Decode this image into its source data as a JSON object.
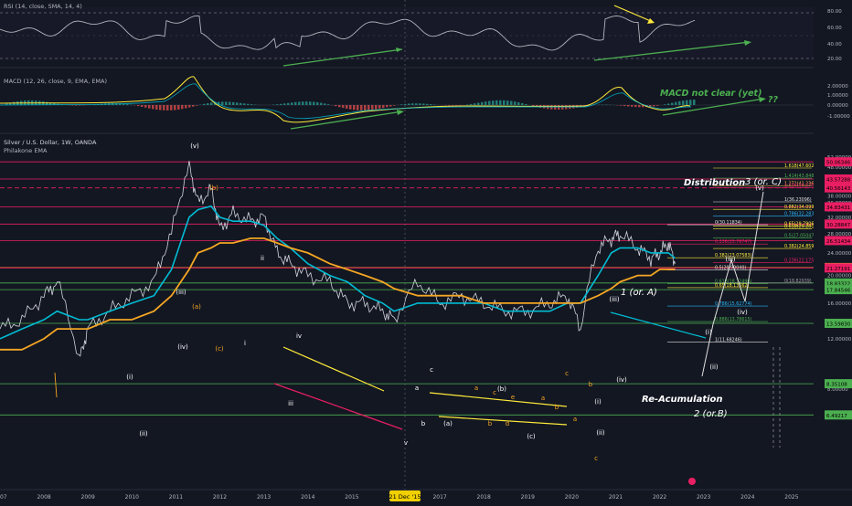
{
  "panes": {
    "rsi": {
      "title": "RSI (14, close, SMA, 14, 4)",
      "ticks": [
        "80.00",
        "60.00",
        "40.00",
        "20.00"
      ]
    },
    "macd": {
      "title": "MACD (12, 26, close, 9, EMA, EMA)",
      "ticks": [
        "2.00000",
        "1.00000",
        "0.00000",
        "-1.00000"
      ],
      "annotation": "MACD not clear (yet)",
      "question": "??"
    },
    "price": {
      "title": "Silver / U.S. Dollar, 1W, OANDA",
      "indicator": "Philakone EMA",
      "ticks": [
        "52.00000",
        "48.00000",
        "44.00000",
        "42.00000",
        "38.00000",
        "36.00000",
        "34.00000",
        "32.00000",
        "28.00000",
        "24.00000",
        "20.00000",
        "16.00000",
        "12.00000",
        "8.00000"
      ]
    }
  },
  "price_tags": [
    {
      "label": "50.06346",
      "color": "#e91e63"
    },
    {
      "label": "43.57288",
      "color": "#e91e63"
    },
    {
      "label": "40.56143",
      "color": "#e91e63"
    },
    {
      "label": "34.83431",
      "color": "#e91e63"
    },
    {
      "label": "30.28847",
      "color": "#e91e63"
    },
    {
      "label": "26.51434",
      "color": "#e91e63"
    },
    {
      "label": "21.32750",
      "color": "#f5a623"
    },
    {
      "label": "21.27191",
      "color": "#e91e63"
    },
    {
      "label": "18.83322",
      "color": "#4caf50"
    },
    {
      "label": "17.84546",
      "color": "#4caf50"
    },
    {
      "label": "13.59830",
      "color": "#4caf50"
    },
    {
      "label": "8.35108",
      "color": "#4caf50"
    },
    {
      "label": "6.49217",
      "color": "#4caf50"
    }
  ],
  "fib_levels": [
    {
      "label": "1.618(47.60276)",
      "color": "#ffeb3b"
    },
    {
      "label": "1.414(43.8489)",
      "color": "#4caf50"
    },
    {
      "label": "1.272(41.23602)",
      "color": "#ffb74d"
    },
    {
      "label": "1.236(40.57059)",
      "color": "#e91e63"
    },
    {
      "label": "1(36.23096)",
      "color": "#e0e0e0"
    },
    {
      "label": "0.882(34.09964)",
      "color": "#ffeb3b"
    },
    {
      "label": "0.786(32.28319)",
      "color": "#29b6f6"
    },
    {
      "label": "0.65(29.79067)",
      "color": "#ffeb3b"
    },
    {
      "label": "0.618(29.20179)",
      "color": "#ffeb3b"
    },
    {
      "label": "0.5(27.05047)",
      "color": "#4caf50"
    },
    {
      "label": "0.382(24.85916)",
      "color": "#ffeb3b"
    },
    {
      "label": "0.236(22.17562)",
      "color": "#e91e63"
    },
    {
      "label": "0(18.82939)",
      "color": "#9e9e9e"
    }
  ],
  "fib_levels_left": [
    {
      "label": "0(30.11834)",
      "color": "#e0e0e0"
    },
    {
      "label": "0.236(25.76747)",
      "color": "#e91e63"
    },
    {
      "label": "0.382(23.07583)",
      "color": "#ffeb3b"
    },
    {
      "label": "0.5(20.90040)",
      "color": "#e0e0e0"
    },
    {
      "label": "0.618(18.72496)",
      "color": "#4caf50"
    },
    {
      "label": "0.65(18.13562)",
      "color": "#ffeb3b"
    },
    {
      "label": "0.786(15.62774)",
      "color": "#29b6f6"
    },
    {
      "label": "0.886(13.78615)",
      "color": "#4caf50"
    },
    {
      "label": "1(11.68246)",
      "color": "#e0e0e0"
    }
  ],
  "wave_labels": [
    {
      "text": "(v)",
      "color": "#ffffff"
    },
    {
      "text": "(b)",
      "color": "#f5a623"
    },
    {
      "text": "(iii)",
      "color": "#ffffff"
    },
    {
      "text": "(a)",
      "color": "#f5a623"
    },
    {
      "text": "(iv)",
      "color": "#ffffff"
    },
    {
      "text": "(c)",
      "color": "#f5a623"
    },
    {
      "text": "ii",
      "color": "#ffffff"
    },
    {
      "text": "i",
      "color": "#ffffff"
    },
    {
      "text": "(i)",
      "color": "#ffffff"
    },
    {
      "text": "(ii)",
      "color": "#ffffff"
    },
    {
      "text": "iii",
      "color": "#ffffff"
    },
    {
      "text": "iv",
      "color": "#ffffff"
    },
    {
      "text": "v",
      "color": "#ffffff"
    },
    {
      "text": "a",
      "color": "#ffffff"
    },
    {
      "text": "b",
      "color": "#ffffff"
    },
    {
      "text": "c",
      "color": "#ffffff"
    },
    {
      "text": "(a)",
      "color": "#ffffff"
    },
    {
      "text": "(b)",
      "color": "#ffffff"
    },
    {
      "text": "(c)",
      "color": "#ffffff"
    },
    {
      "text": "a",
      "color": "#f5a623"
    },
    {
      "text": "b",
      "color": "#f5a623"
    },
    {
      "text": "c",
      "color": "#f5a623"
    },
    {
      "text": "d",
      "color": "#f5a623"
    },
    {
      "text": "e",
      "color": "#f5a623"
    },
    {
      "text": "a",
      "color": "#f5a623"
    },
    {
      "text": "b",
      "color": "#f5a623"
    },
    {
      "text": "c",
      "color": "#f5a623"
    },
    {
      "text": "(i)",
      "color": "#ffffff"
    },
    {
      "text": "(ii)",
      "color": "#ffffff"
    },
    {
      "text": "(iii)",
      "color": "#ffffff"
    },
    {
      "text": "(iv)",
      "color": "#ffffff"
    },
    {
      "text": "a",
      "color": "#f5a623"
    },
    {
      "text": "b",
      "color": "#f5a623"
    },
    {
      "text": "c",
      "color": "#f5a623"
    },
    {
      "text": "(i)",
      "color": "#ffffff"
    },
    {
      "text": "(ii)",
      "color": "#ffffff"
    },
    {
      "text": "(iii)",
      "color": "#ffffff"
    },
    {
      "text": "(iv)",
      "color": "#ffffff"
    },
    {
      "text": "(v)",
      "color": "#ffffff"
    }
  ],
  "annotations": {
    "wave1": "1 (or. A)",
    "wave2": "2 (or.B)",
    "wave3": "3 (or. C)",
    "distribution": "Distribution",
    "reaccumulation": "Re-Acumulation"
  },
  "x_axis": {
    "ticks": [
      "2007",
      "2008",
      "2009",
      "2010",
      "2011",
      "2012",
      "2013",
      "2014",
      "2015",
      "2017",
      "2018",
      "2019",
      "2020",
      "2021",
      "2022",
      "2023",
      "2024",
      "2025"
    ],
    "highlight": "21 Dec '15"
  },
  "colors": {
    "background": "#131722",
    "price_line": "#d1d4dc",
    "ema_fast": "#00bcd4",
    "ema_slow": "#f5a623",
    "rsi_line": "#b2b5be",
    "trend_green": "#4caf50",
    "trend_red": "#e91e63",
    "macd_line": "#ffeb3b"
  },
  "chart_data": {
    "type": "line",
    "title": "Silver / U.S. Dollar, 1W, OANDA",
    "x": [
      2007,
      2007.5,
      2008,
      2008.3,
      2008.8,
      2009,
      2009.5,
      2010,
      2010.5,
      2010.9,
      2011.3,
      2011.5,
      2011.8,
      2012,
      2012.3,
      2012.7,
      2013,
      2013.3,
      2013.6,
      2014,
      2014.5,
      2014.9,
      2015.3,
      2015.7,
      2015.96,
      2016.5,
      2017,
      2017.5,
      2018,
      2018.5,
      2019,
      2019.5,
      2019.9,
      2020.2,
      2020.6,
      2020.9,
      2021.1,
      2021.5,
      2021.8,
      2022,
      2022.2,
      2022.35
    ],
    "values": [
      13,
      14,
      17,
      19,
      10,
      13,
      15,
      17,
      19,
      28,
      48,
      36,
      40,
      29,
      33,
      31,
      32,
      24,
      22,
      20,
      19,
      16,
      16,
      15,
      14,
      19,
      16,
      17,
      16,
      15,
      15,
      16,
      17,
      13,
      25,
      27,
      28,
      25,
      23,
      24,
      26,
      22
    ],
    "ylim": [
      4,
      52
    ],
    "xlim": [
      2007,
      2025.5
    ],
    "grid": false,
    "series": [
      {
        "name": "Philakone EMA",
        "values": [
          12,
          13,
          14,
          15,
          14,
          14,
          15,
          16,
          17,
          21,
          32,
          34,
          35,
          32,
          31,
          31,
          30,
          27,
          25,
          22,
          20,
          19,
          17,
          16,
          15,
          16,
          16,
          16,
          16,
          15,
          15,
          15,
          16,
          16,
          20,
          24,
          25,
          25,
          24,
          24,
          24,
          23
        ]
      },
      {
        "name": "Philakone EMA",
        "values": [
          11,
          11,
          12,
          13,
          13,
          13,
          14,
          14,
          15,
          17,
          21,
          24,
          25,
          26,
          26,
          27,
          27,
          26,
          25,
          24,
          22,
          21,
          20,
          19,
          18,
          17,
          17,
          17,
          16,
          16,
          16,
          16,
          16,
          16,
          17,
          18,
          19,
          20,
          20,
          21,
          21,
          21
        ]
      }
    ]
  }
}
